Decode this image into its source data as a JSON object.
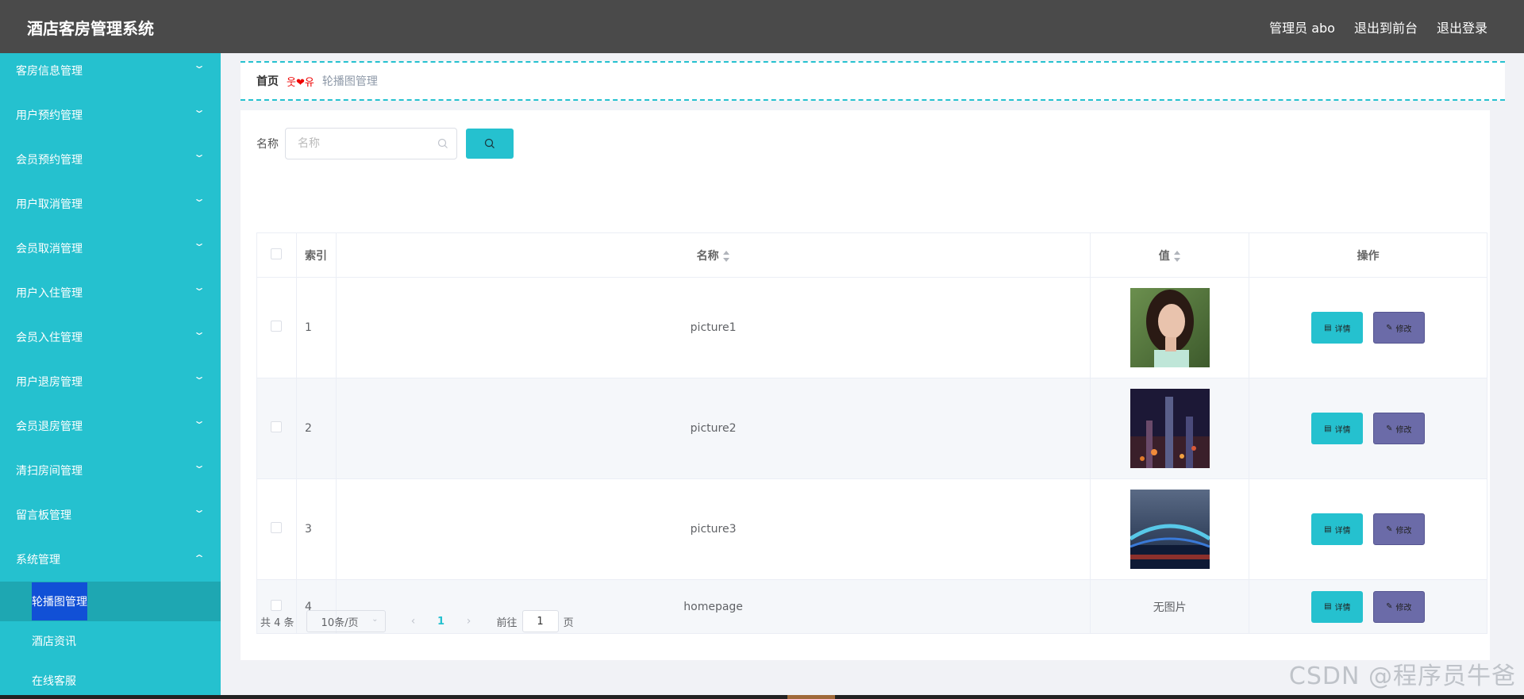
{
  "header": {
    "app_title": "酒店客房管理系统",
    "admin_label": "管理员 abo",
    "to_front": "退出到前台",
    "logout": "退出登录"
  },
  "sidebar": {
    "items": [
      {
        "label": "客房信息管理"
      },
      {
        "label": "用户预约管理"
      },
      {
        "label": "会员预约管理"
      },
      {
        "label": "用户取消管理"
      },
      {
        "label": "会员取消管理"
      },
      {
        "label": "用户入住管理"
      },
      {
        "label": "会员入住管理"
      },
      {
        "label": "用户退房管理"
      },
      {
        "label": "会员退房管理"
      },
      {
        "label": "清扫房间管理"
      },
      {
        "label": "留言板管理"
      },
      {
        "label": "系统管理"
      }
    ],
    "sub_items": [
      {
        "label": "轮播图管理"
      },
      {
        "label": "酒店资讯"
      },
      {
        "label": "在线客服"
      }
    ]
  },
  "breadcrumb": {
    "home": "首页",
    "separator": "웃❤유",
    "current": "轮播图管理"
  },
  "search": {
    "label": "名称",
    "placeholder": "名称"
  },
  "table": {
    "headers": {
      "index": "索引",
      "name": "名称",
      "value": "值",
      "actions": "操作"
    },
    "rows": [
      {
        "index": "1",
        "name": "picture1",
        "image": "portrait-photo"
      },
      {
        "index": "2",
        "name": "picture2",
        "image": "city-night-photo"
      },
      {
        "index": "3",
        "name": "picture3",
        "image": "bridge-night-photo"
      },
      {
        "index": "4",
        "name": "homepage",
        "value_text": "无图片"
      }
    ],
    "detail_label": "详情",
    "edit_label": "修改"
  },
  "pagination": {
    "total": "共 4 条",
    "page_size": "10条/页",
    "current_page": "1",
    "goto_label": "前往",
    "goto_value": "1",
    "page_suffix": "页"
  },
  "watermark": "CSDN @程序员牛爸",
  "colors": {
    "accent": "#25c1cf",
    "header_bg": "#4a4a4a",
    "edit_btn": "#6b6ba8",
    "active_sub": "#1150d6"
  }
}
